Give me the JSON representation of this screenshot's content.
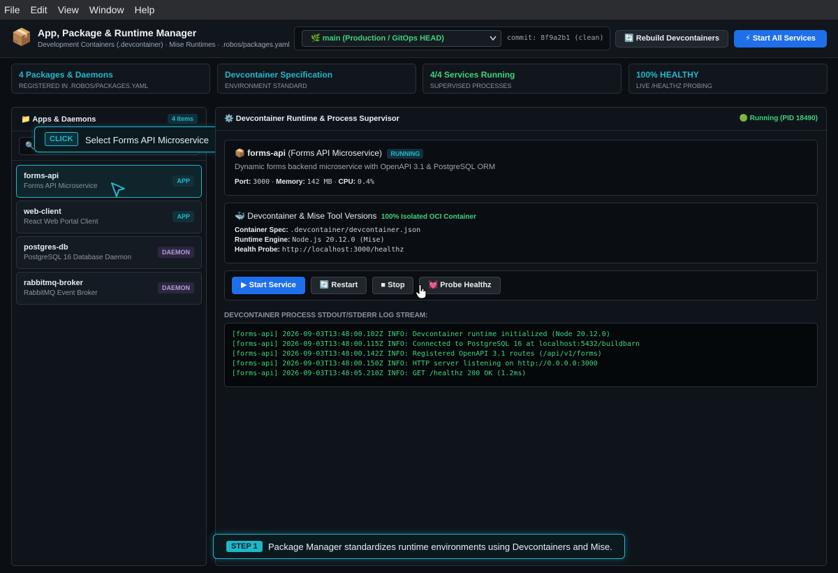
{
  "menu": [
    "File",
    "Edit",
    "View",
    "Window",
    "Help"
  ],
  "header": {
    "logo_icon": "📦",
    "title": "App, Package & Runtime Manager",
    "subtitle": "Development Containers (.devcontainer) · Mise Runtimes · .robos/packages.yaml",
    "branch": "🌿 main (Production / GitOps HEAD)",
    "commit": "commit: 8f9a2b1 (clean)",
    "rebuild_label": "🔄 Rebuild Devcontainers",
    "start_all_label": "⚡ Start All Services"
  },
  "stats": [
    {
      "value": "4 Packages & Daemons",
      "label": "Registered in .robos/packages.yaml"
    },
    {
      "value": "Devcontainer Specification",
      "label": "Environment Standard"
    },
    {
      "value": "4/4 Services Running",
      "label": "Supervised Processes"
    },
    {
      "value": "100% HEALTHY",
      "label": "Live /healthz probing"
    }
  ],
  "sidebar": {
    "title": "📁 Apps & Daemons",
    "count": "4 Items",
    "search_icon": "🔍",
    "items": [
      {
        "name": "forms-api",
        "desc": "Forms API Microservice",
        "badge": "APP"
      },
      {
        "name": "web-client",
        "desc": "React Web Portal Client",
        "badge": "APP"
      },
      {
        "name": "postgres-db",
        "desc": "PostgreSQL 16 Database Daemon",
        "badge": "DAEMON"
      },
      {
        "name": "rabbitmq-broker",
        "desc": "RabbitMQ Event Broker",
        "badge": "DAEMON"
      }
    ]
  },
  "tooltip": {
    "tag": "CLICK",
    "text": "Select Forms API Microservice"
  },
  "main": {
    "title": "⚙️ Devcontainer Runtime & Process Supervisor",
    "status": "🟢 Running (PID 18490)",
    "service": {
      "icon": "📦",
      "name": "forms-api",
      "full": "(Forms API Microservice)",
      "state": "RUNNING",
      "desc": "Dynamic forms backend microservice with OpenAPI 3.1 & PostgreSQL ORM",
      "port_label": "Port:",
      "port": "3000",
      "mem_label": "Memory:",
      "mem": "142 MB",
      "cpu_label": "CPU:",
      "cpu": "0.4%"
    },
    "devcontainer": {
      "title": "🐳 Devcontainer & Mise Tool Versions",
      "badge": "100% Isolated OCI Container",
      "spec_label": "Container Spec:",
      "spec": ".devcontainer/devcontainer.json",
      "engine_label": "Runtime Engine:",
      "engine": "Node.js 20.12.0 (Mise)",
      "probe_label": "Health Probe:",
      "probe": "http://localhost:3000/healthz"
    },
    "actions": {
      "start": "▶ Start Service",
      "restart": "🔄 Restart",
      "stop": "■ Stop",
      "probe": "💓 Probe Healthz"
    },
    "log_label": "DEVCONTAINER PROCESS STDOUT/STDERR LOG STREAM:",
    "logs": [
      "[forms-api] 2026-09-03T13:48:00.102Z INFO: Devcontainer runtime initialized (Node 20.12.0)",
      "[forms-api] 2026-09-03T13:48:00.115Z INFO: Connected to PostgreSQL 16 at localhost:5432/buildbarn",
      "[forms-api] 2026-09-03T13:48:00.142Z INFO: Registered OpenAPI 3.1 routes (/api/v1/forms)",
      "[forms-api] 2026-09-03T13:48:00.150Z INFO: HTTP server listening on http://0.0.0.0:3000",
      "[forms-api] 2026-09-03T13:48:05.210Z INFO: GET /healthz 200 OK (1.2ms)"
    ]
  },
  "step": {
    "tag": "STEP 1",
    "text": "Package Manager standardizes runtime environments using Devcontainers and Mise."
  }
}
